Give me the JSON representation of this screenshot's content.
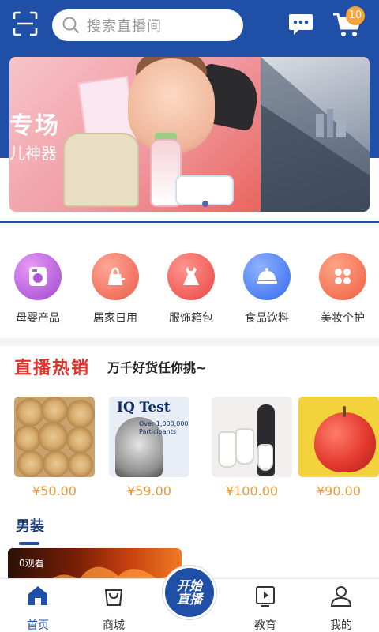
{
  "header": {
    "search_placeholder": "搜索直播间",
    "cart_count": "10",
    "icons": [
      "scan-icon",
      "search-icon",
      "message-icon",
      "cart-icon"
    ]
  },
  "banner": {
    "text_line1": "专场",
    "text_line2": "儿神器"
  },
  "categories": [
    {
      "label": "母婴产品",
      "icon": "washing-machine-icon",
      "color": "#b05bd8"
    },
    {
      "label": "居家日用",
      "icon": "home-goods-icon",
      "color": "#f06e5c"
    },
    {
      "label": "服饰箱包",
      "icon": "dress-icon",
      "color": "#ee5a55"
    },
    {
      "label": "食品饮料",
      "icon": "food-cloche-icon",
      "color": "#4a7cf0"
    },
    {
      "label": "美妆个护",
      "icon": "beauty-icon",
      "color": "#f36f52"
    }
  ],
  "live_hot": {
    "title": "直播热销",
    "subtitle": "万千好货任你挑~"
  },
  "products": [
    {
      "price": "¥50.00"
    },
    {
      "price": "¥59.00",
      "image_text": "IQ Test",
      "image_subtext": "Over 1,000,000 Participants"
    },
    {
      "price": "¥100.00"
    },
    {
      "price": "¥90.00"
    }
  ],
  "section": {
    "title": "男装",
    "video_views": "0观看"
  },
  "bottom_nav": [
    {
      "label": "首页",
      "icon": "home-icon",
      "active": true
    },
    {
      "label": "商城",
      "icon": "shopping-bag-icon",
      "active": false
    },
    {
      "label": "教育",
      "icon": "video-book-icon",
      "active": false
    },
    {
      "label": "我的",
      "icon": "user-icon",
      "active": false
    }
  ],
  "live_button": {
    "label": "开始直播"
  },
  "colors": {
    "brand_blue": "#1f4fa6",
    "hot_red": "#e1322d",
    "price_orange": "#e59a3e",
    "badge_orange": "#f7a23b"
  }
}
